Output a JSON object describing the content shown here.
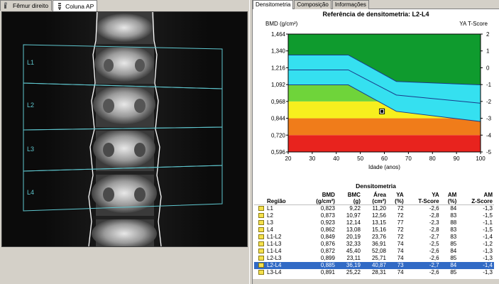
{
  "left_tabs": [
    {
      "label": "Fêmur direito",
      "icon": "femur-icon"
    },
    {
      "label": "Coluna AP",
      "icon": "spine-icon"
    }
  ],
  "scan": {
    "regions": [
      "L1",
      "L2",
      "L3",
      "L4"
    ]
  },
  "right_tabs": [
    "Densitometria",
    "Composição",
    "Informações"
  ],
  "chart": {
    "title": "Referência de densitometria: L2-L4",
    "ylabel_left": "BMD (g/cm²)",
    "ylabel_right": "YA T-Score",
    "xlabel": "Idade (anos)"
  },
  "chart_data": {
    "type": "area",
    "title": "Referência de densitometria: L2-L4",
    "xlabel": "Idade (anos)",
    "ylabel": "BMD (g/cm²)",
    "y2label": "YA T-Score",
    "xlim": [
      20,
      100
    ],
    "ylim": [
      0.596,
      1.464
    ],
    "x_ticks": [
      "20",
      "30",
      "40",
      "50",
      "60",
      "70",
      "80",
      "90",
      "100"
    ],
    "y_ticks": [
      "0,596",
      "0,720",
      "0,844",
      "0,968",
      "1,092",
      "1,216",
      "1,340",
      "1,464"
    ],
    "y2_ticks": [
      "-5",
      "-4",
      "-3",
      "-2",
      "-1",
      "0",
      "1",
      "2"
    ],
    "bands": [
      {
        "name": "red",
        "color": "#e8231e",
        "lower": 0.596,
        "upper": 0.72
      },
      {
        "name": "orange",
        "color": "#f07c1a",
        "lower": 0.72,
        "upper": 0.844
      },
      {
        "name": "yellow",
        "color": "#f7ef1e",
        "lower": 0.844,
        "upper": 0.968
      },
      {
        "name": "light-green",
        "color": "#6fd43a",
        "lower": 0.968,
        "upper": 1.092
      },
      {
        "name": "green",
        "color": "#0f9b2e",
        "lower": 1.092,
        "upper": 1.464
      }
    ],
    "reference_curve": {
      "x": [
        20,
        45,
        65,
        100
      ],
      "upper": [
        1.31,
        1.31,
        1.115,
        1.09
      ],
      "mean": [
        1.2,
        1.2,
        1.015,
        0.955
      ],
      "lower": [
        1.09,
        1.09,
        0.895,
        0.82
      ],
      "fill": "#35e0f0"
    },
    "patient_point": {
      "x": 59,
      "y": 0.895
    }
  },
  "table": {
    "title": "Densitometria",
    "headers": [
      "Região",
      "BMD\n(g/cm²)",
      "BMC\n(g)",
      "Área\n(cm²)",
      "YA\n(%)",
      "YA\nT-Score",
      "AM\n(%)",
      "AM\nZ-Score"
    ],
    "rows": [
      {
        "region": "L1",
        "bmd": "0,823",
        "bmc": "9,22",
        "area": "11,20",
        "ya": "72",
        "t": "-2,6",
        "am": "84",
        "z": "-1,3"
      },
      {
        "region": "L2",
        "bmd": "0,873",
        "bmc": "10,97",
        "area": "12,56",
        "ya": "72",
        "t": "-2,8",
        "am": "83",
        "z": "-1,5"
      },
      {
        "region": "L3",
        "bmd": "0,923",
        "bmc": "12,14",
        "area": "13,15",
        "ya": "77",
        "t": "-2,3",
        "am": "88",
        "z": "-1,1"
      },
      {
        "region": "L4",
        "bmd": "0,862",
        "bmc": "13,08",
        "area": "15,16",
        "ya": "72",
        "t": "-2,8",
        "am": "83",
        "z": "-1,5"
      },
      {
        "region": "L1-L2",
        "bmd": "0,849",
        "bmc": "20,19",
        "area": "23,76",
        "ya": "72",
        "t": "-2,7",
        "am": "83",
        "z": "-1,4"
      },
      {
        "region": "L1-L3",
        "bmd": "0,876",
        "bmc": "32,33",
        "area": "36,91",
        "ya": "74",
        "t": "-2,5",
        "am": "85",
        "z": "-1,2"
      },
      {
        "region": "L1-L4",
        "bmd": "0,872",
        "bmc": "45,40",
        "area": "52,08",
        "ya": "74",
        "t": "-2,6",
        "am": "84",
        "z": "-1,3"
      },
      {
        "region": "L2-L3",
        "bmd": "0,899",
        "bmc": "23,11",
        "area": "25,71",
        "ya": "74",
        "t": "-2,6",
        "am": "85",
        "z": "-1,3"
      },
      {
        "region": "L2-L4",
        "bmd": "0,885",
        "bmc": "36,19",
        "area": "40,87",
        "ya": "73",
        "t": "-2,7",
        "am": "84",
        "z": "-1,4",
        "selected": true
      },
      {
        "region": "L3-L4",
        "bmd": "0,891",
        "bmc": "25,22",
        "area": "28,31",
        "ya": "74",
        "t": "-2,6",
        "am": "85",
        "z": "-1,3"
      }
    ]
  }
}
